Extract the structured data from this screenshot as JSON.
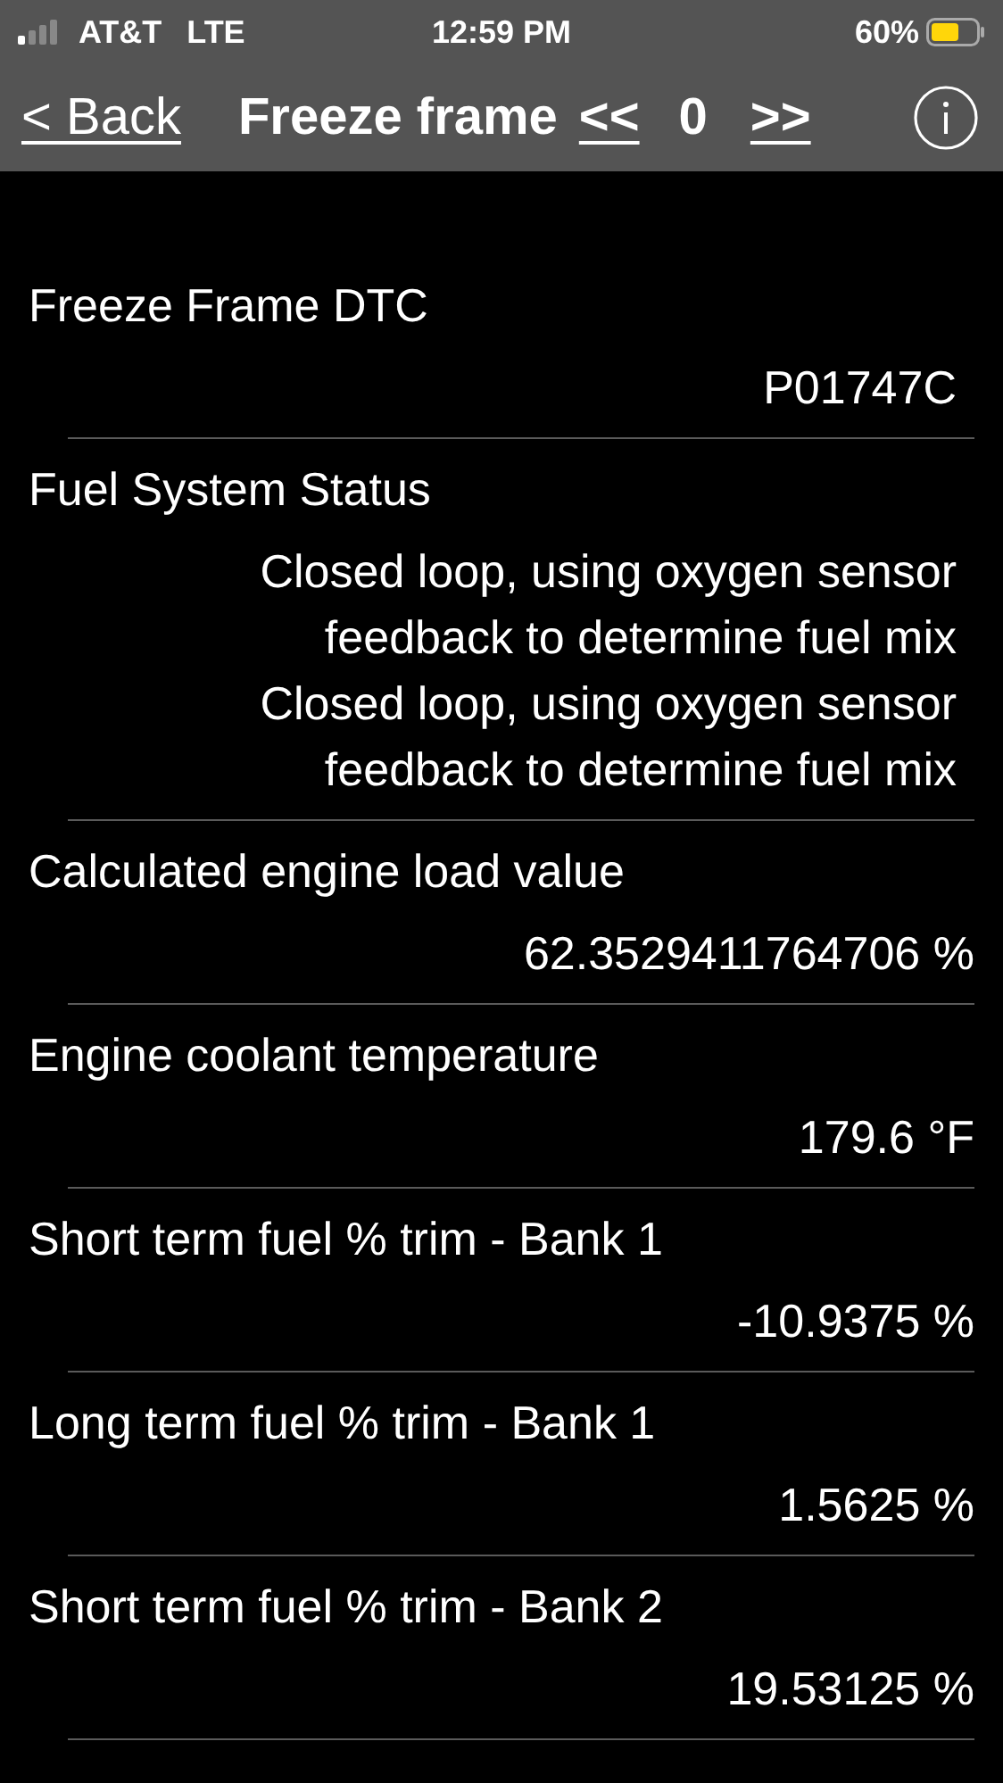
{
  "status_bar": {
    "carrier": "AT&T",
    "network": "LTE",
    "time": "12:59 PM",
    "battery": "60%"
  },
  "nav": {
    "back": "< Back",
    "title": "Freeze frame",
    "prev": "<<",
    "frame": "0",
    "next": ">>"
  },
  "rows": [
    {
      "kind": "status",
      "label": "Freeze Frame DTC",
      "values": [
        "P01747C"
      ]
    },
    {
      "kind": "status",
      "label": "Fuel System Status",
      "values": [
        "Closed loop, using oxygen sensor feedback to determine fuel mix",
        "Closed loop, using oxygen sensor feedback to determine fuel mix"
      ]
    },
    {
      "kind": "reading",
      "label": "Calculated engine load value",
      "values": [
        "62.3529411764706 %"
      ]
    },
    {
      "kind": "reading",
      "label": "Engine coolant temperature",
      "values": [
        "179.6 °F"
      ]
    },
    {
      "kind": "reading",
      "label": "Short term fuel % trim - Bank 1",
      "values": [
        "-10.9375 %"
      ]
    },
    {
      "kind": "reading",
      "label": "Long term fuel % trim - Bank 1",
      "values": [
        "1.5625 %"
      ]
    },
    {
      "kind": "reading",
      "label": "Short term fuel % trim - Bank 2",
      "values": [
        "19.53125 %"
      ]
    }
  ]
}
